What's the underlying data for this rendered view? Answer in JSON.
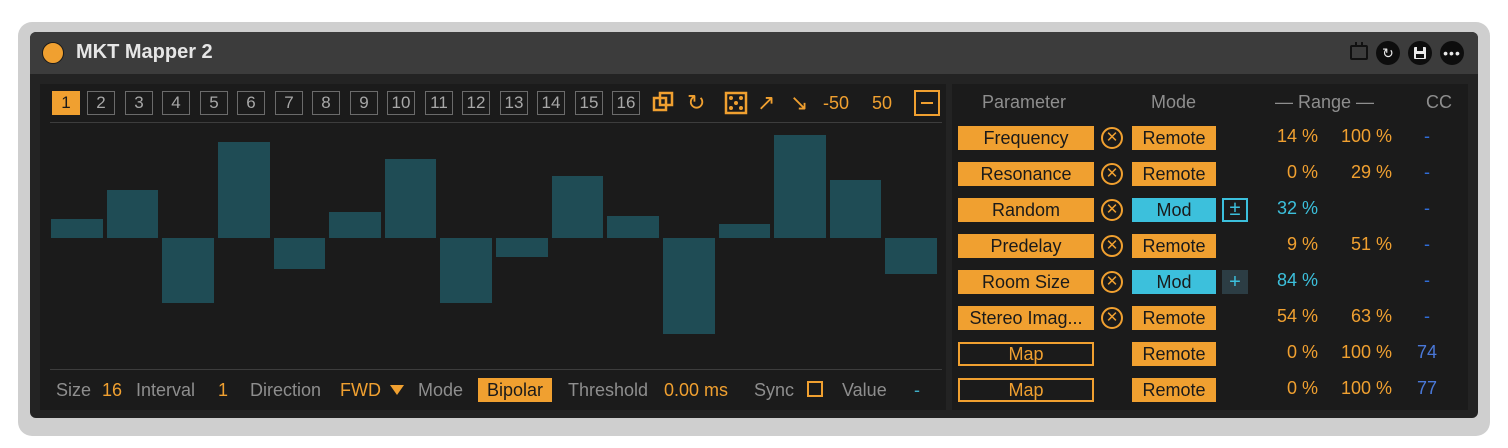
{
  "device": {
    "title": "MKT Mapper 2",
    "title_icons": [
      "calendar-icon",
      "refresh-icon",
      "save-icon",
      "more-icon"
    ]
  },
  "steps": [
    "1",
    "2",
    "3",
    "4",
    "5",
    "6",
    "7",
    "8",
    "9",
    "10",
    "11",
    "12",
    "13",
    "14",
    "15",
    "16"
  ],
  "active_step": "1",
  "toolbar": {
    "icons": [
      "copy-icon",
      "sync-icon",
      "dice-icon",
      "arrow-up-right-icon",
      "arrow-down-right-icon",
      "minus-icon"
    ],
    "min_value": "-50",
    "max_value": "50"
  },
  "sequence": {
    "range": [
      -50,
      50
    ],
    "values": [
      8,
      20,
      -27,
      40,
      -13,
      11,
      33,
      -27,
      -8,
      26,
      9,
      -40,
      6,
      43,
      24,
      -15
    ]
  },
  "bottom": {
    "size_label": "Size",
    "size_value": "16",
    "interval_label": "Interval",
    "interval_value": "1",
    "direction_label": "Direction",
    "direction_value": "FWD",
    "mode_label": "Mode",
    "mode_value": "Bipolar",
    "threshold_label": "Threshold",
    "threshold_value": "0.00 ms",
    "sync_label": "Sync",
    "sync_checked": false,
    "value_label": "Value",
    "value_value": "-"
  },
  "mapping": {
    "headers": {
      "parameter": "Parameter",
      "mode": "Mode",
      "range": "— Range —",
      "cc": "CC"
    },
    "rows": [
      {
        "param": "Frequency",
        "mode": "Remote",
        "min": "14 %",
        "max": "100 %",
        "cc": "-"
      },
      {
        "param": "Resonance",
        "mode": "Remote",
        "min": "0 %",
        "max": "29 %",
        "cc": "-"
      },
      {
        "param": "Random",
        "mode": "Mod",
        "plus": "±",
        "min": "32 %",
        "max": "",
        "cc": "-"
      },
      {
        "param": "Predelay",
        "mode": "Remote",
        "min": "9 %",
        "max": "51 %",
        "cc": "-"
      },
      {
        "param": "Room Size",
        "mode": "Mod",
        "plus": "+",
        "min": "84 %",
        "max": "",
        "cc": "-"
      },
      {
        "param": "Stereo Imag...",
        "mode": "Remote",
        "min": "54 %",
        "max": "63 %",
        "cc": "-"
      },
      {
        "param": "Map",
        "mode": "Remote",
        "min": "0 %",
        "max": "100 %",
        "cc": "74"
      },
      {
        "param": "Map",
        "mode": "Remote",
        "min": "0 %",
        "max": "100 %",
        "cc": "77"
      }
    ]
  },
  "colors": {
    "accent": "#f0a030",
    "mod": "#3cc0dc",
    "bar": "#1f4c55",
    "cc_blue": "#2f6cd8"
  }
}
